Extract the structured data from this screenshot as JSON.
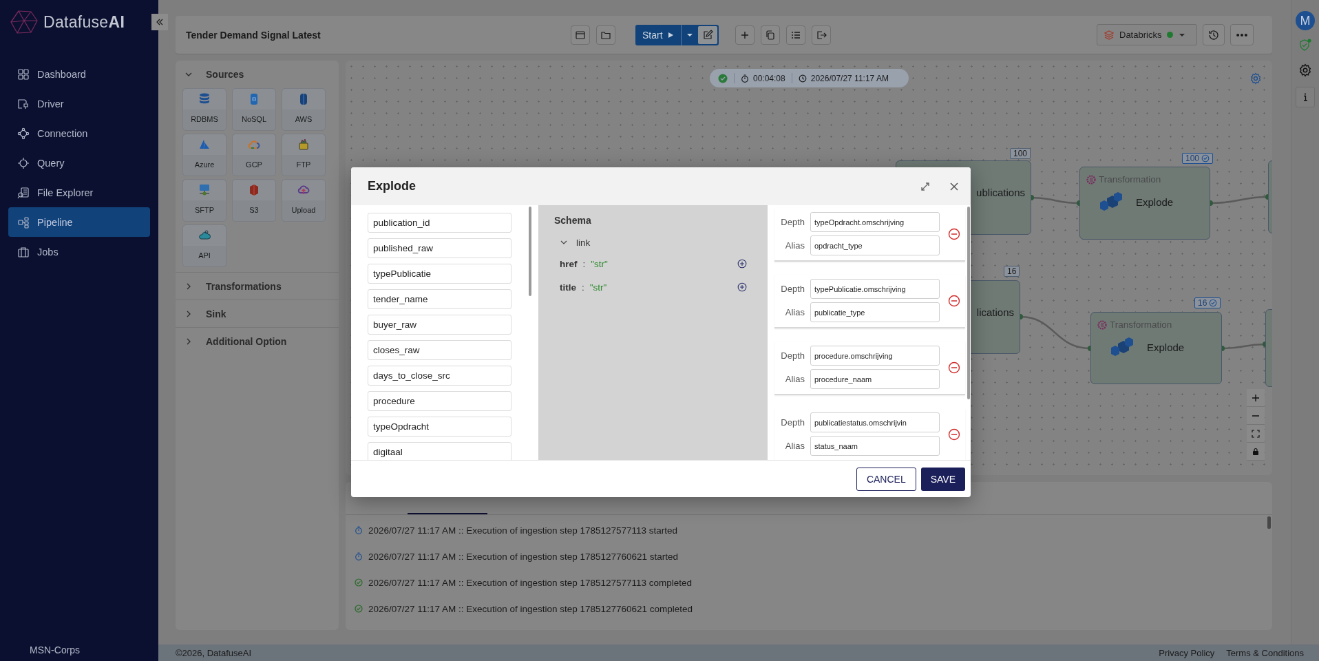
{
  "sidebar": {
    "brand": {
      "name": "Datafuse",
      "emphasis": "AI"
    },
    "items": [
      {
        "label": "Dashboard",
        "selected": false
      },
      {
        "label": "Driver",
        "selected": false
      },
      {
        "label": "Connection",
        "selected": false
      },
      {
        "label": "Query",
        "selected": false
      },
      {
        "label": "File Explorer",
        "selected": false
      },
      {
        "label": "Pipeline",
        "selected": true
      },
      {
        "label": "Jobs",
        "selected": false
      }
    ],
    "org": "MSN-Corps"
  },
  "header": {
    "title": "Tender Demand Signal Latest",
    "start": "Start",
    "engine": {
      "label": "Databricks",
      "connected": true
    }
  },
  "rail": {
    "avatar": "M",
    "security_alert": true
  },
  "palette": [
    {
      "label": "Sources",
      "expanded": true,
      "tiles": [
        "RDBMS",
        "NoSQL",
        "AWS",
        "Azure",
        "GCP",
        "FTP",
        "SFTP",
        "S3",
        "Upload",
        "API"
      ]
    },
    {
      "label": "Transformations",
      "expanded": false
    },
    {
      "label": "Sink",
      "expanded": false
    },
    {
      "label": "Additional Option",
      "expanded": false
    }
  ],
  "run_status": {
    "succeeded": true,
    "duration": "00:04:08",
    "timestamp": "2026/07/27 11:17 AM"
  },
  "flows": [
    {
      "source": {
        "label": "ublications",
        "count": "100"
      },
      "transform": {
        "type": "Transformation",
        "label": "Explode",
        "count": "100",
        "validated": true
      }
    },
    {
      "source": {
        "label": "lications",
        "count": "16"
      },
      "transform": {
        "type": "Transformation",
        "label": "Explode",
        "count": "16",
        "validated": true
      }
    }
  ],
  "log": [
    {
      "kind": "started",
      "text": "2026/07/27 11:17 AM :: Execution of ingestion step 1785127577113 started"
    },
    {
      "kind": "started",
      "text": "2026/07/27 11:17 AM :: Execution of ingestion step 1785127760621 started"
    },
    {
      "kind": "completed",
      "text": "2026/07/27 11:17 AM :: Execution of ingestion step 1785127577113 completed"
    },
    {
      "kind": "completed",
      "text": "2026/07/27 11:17 AM :: Execution of ingestion step 1785127760621 completed"
    }
  ],
  "modal": {
    "title": "Explode",
    "columns": [
      "publication_id",
      "published_raw",
      "typePublicatie",
      "tender_name",
      "buyer_raw",
      "closes_raw",
      "days_to_close_src",
      "procedure",
      "typeOpdracht",
      "digitaal"
    ],
    "schema": {
      "title": "Schema",
      "node": {
        "label": "link",
        "expanded": true,
        "children": [
          {
            "key": "href",
            "sep": ":",
            "value": "\"str\""
          },
          {
            "key": "title",
            "sep": ":",
            "value": "\"str\""
          }
        ]
      }
    },
    "mappings": [
      {
        "depth_label": "Depth",
        "depth": "typeOpdracht.omschrijving",
        "alias_label": "Alias",
        "alias": "opdracht_type"
      },
      {
        "depth_label": "Depth",
        "depth": "typePublicatie.omschrijving",
        "alias_label": "Alias",
        "alias": "publicatie_type"
      },
      {
        "depth_label": "Depth",
        "depth": "procedure.omschrijving",
        "alias_label": "Alias",
        "alias": "procedure_naam"
      },
      {
        "depth_label": "Depth",
        "depth": "publicatiestatus.omschrijvin",
        "alias_label": "Alias",
        "alias": "status_naam"
      }
    ],
    "cancel": "CANCEL",
    "save": "SAVE"
  },
  "footer": {
    "copyright": "©2026, DatafuseAI",
    "links": [
      "Privacy Policy",
      "Terms & Conditions"
    ]
  }
}
